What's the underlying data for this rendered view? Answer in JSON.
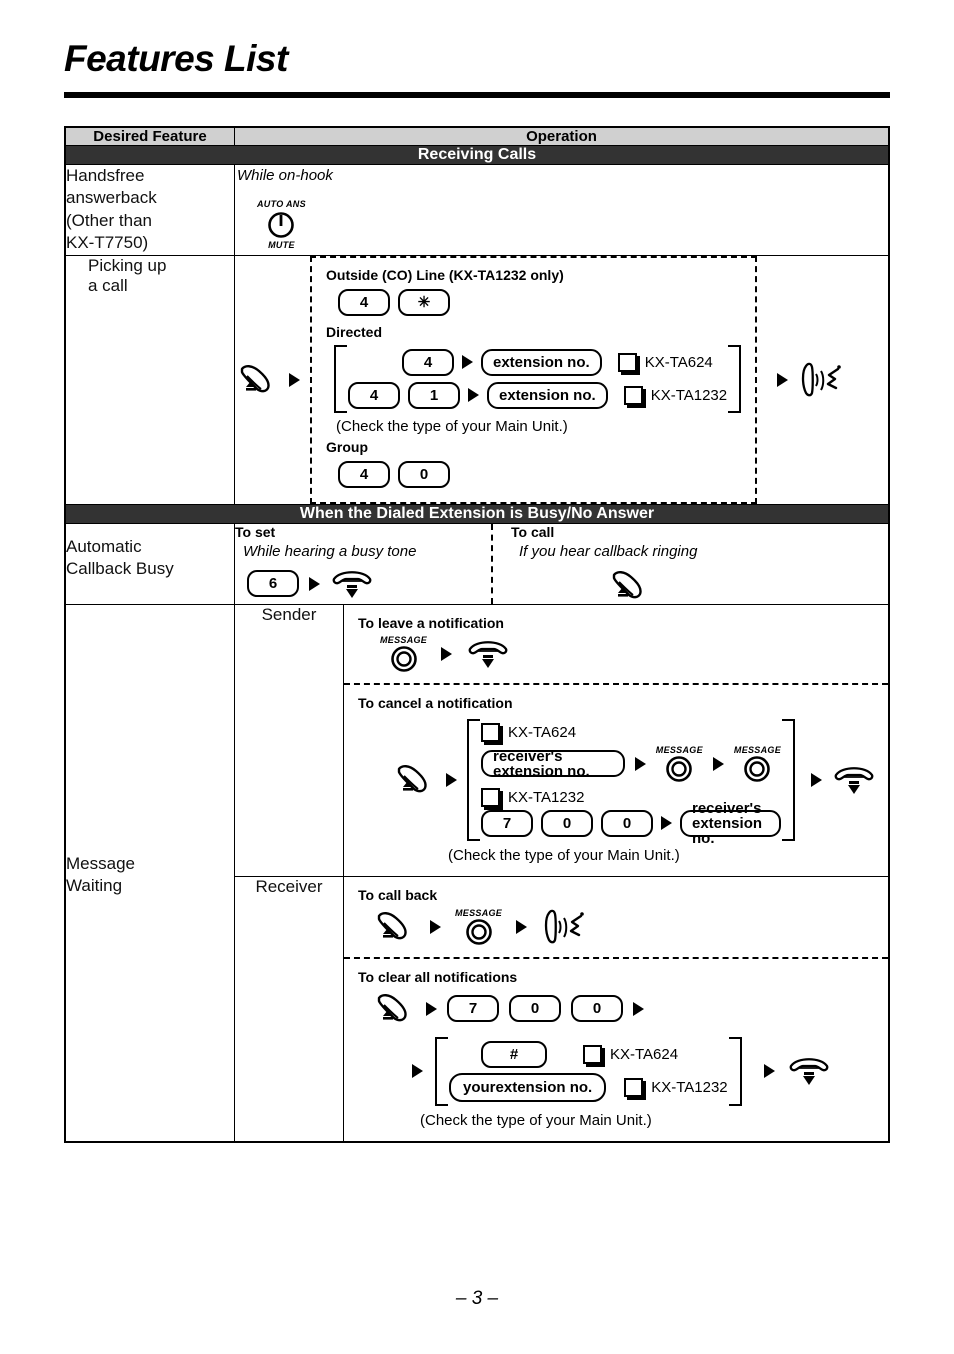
{
  "page": {
    "title": "Features List",
    "page_number": "– 3 –"
  },
  "table": {
    "headers": {
      "feature": "Desired Feature",
      "operation": "Operation"
    },
    "sections": [
      {
        "band": "Receiving Calls"
      },
      {
        "band": "When the Dialed Extension is Busy/No Answer"
      }
    ],
    "rows": {
      "handsfree": {
        "feature_line1": "Handsfree",
        "feature_line2": "answerback",
        "feature_line3": "(Other than",
        "feature_line4": "KX-T7750)",
        "condition": "While on-hook",
        "button_top_label": "AUTO ANS",
        "button_bottom_label": "MUTE"
      },
      "picking_up": {
        "feature_line1": "Picking up",
        "feature_line2": "a call",
        "outside_heading": "Outside (CO) Line (KX-TA1232 only)",
        "outside_keys": [
          "4",
          "✳"
        ],
        "directed_heading": "Directed",
        "directed_variant_a_keys": [
          "4"
        ],
        "directed_variant_a_field": "extension no.",
        "directed_variant_a_model": "KX-TA624",
        "directed_variant_b_keys": [
          "4",
          "1"
        ],
        "directed_variant_b_field": "extension no.",
        "directed_variant_b_model": "KX-TA1232",
        "check_note": "(Check the type of your Main Unit.)",
        "group_heading": "Group",
        "group_keys": [
          "4",
          "0"
        ]
      },
      "callback": {
        "feature_line1": "Automatic",
        "feature_line2": "Callback Busy",
        "to_set_title": "To set",
        "to_set_condition": "While hearing a busy tone",
        "to_set_key": "6",
        "to_call_title": "To call",
        "to_call_condition": "If you hear callback ringing"
      },
      "message_waiting": {
        "feature_line1": "Message",
        "feature_line2": "Waiting",
        "sender_label": "Sender",
        "receiver_label": "Receiver",
        "leave_title": "To leave a notification",
        "message_button_label": "MESSAGE",
        "cancel_title": "To cancel a notification",
        "cancel_model_a": "KX-TA624",
        "cancel_field_a": "receiver's extension no.",
        "cancel_model_b": "KX-TA1232",
        "cancel_keys_b": [
          "7",
          "0",
          "0"
        ],
        "cancel_field_b": "receiver's extension no.",
        "cancel_note": "(Check the type of your Main Unit.)",
        "callback_title": "To call back",
        "clear_title": "To clear all notifications",
        "clear_keys": [
          "7",
          "0",
          "0"
        ],
        "clear_variant_a_key": "#",
        "clear_variant_a_model": "KX-TA624",
        "clear_variant_b_line1": "your",
        "clear_variant_b_line2": "extension no.",
        "clear_variant_b_model": "KX-TA1232",
        "clear_note": "(Check the type of your Main Unit.)"
      }
    }
  },
  "colors": {
    "header_gray": "#d0d0d0",
    "band_dark": "#333333",
    "ink": "#000000"
  },
  "icons": {
    "lift_handset": "lift-handset-icon",
    "hang_up": "hang-up-icon",
    "talk": "talk-icon",
    "message_button": "message-button-icon",
    "auto_ans_mute": "auto-ans-mute-button-icon",
    "arrow": "arrow-right-icon"
  }
}
